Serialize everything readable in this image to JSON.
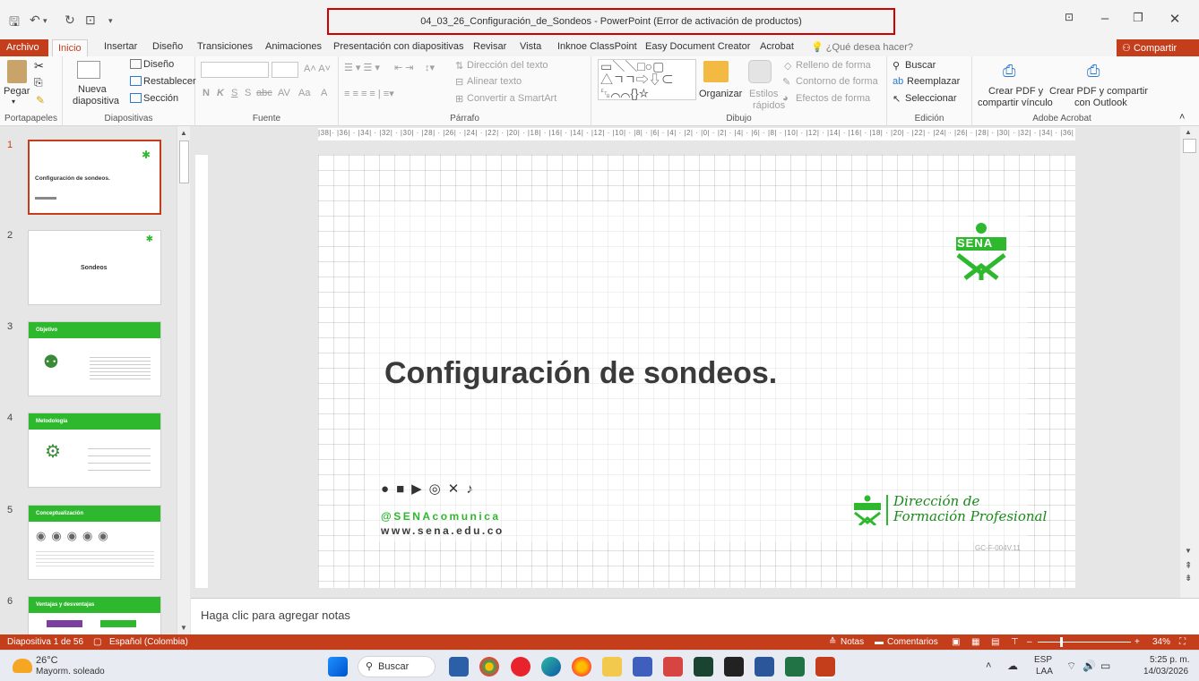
{
  "titlebar": {
    "document_title": "04_03_26_Configuración_de_Sondeos - PowerPoint (Error de activación de productos)"
  },
  "tabs": [
    "Archivo",
    "Inicio",
    "Insertar",
    "Diseño",
    "Transiciones",
    "Animaciones",
    "Presentación con diapositivas",
    "Revisar",
    "Vista",
    "Inknoe ClassPoint",
    "Easy Document Creator",
    "Acrobat"
  ],
  "tell_me": "¿Qué desea hacer?",
  "share_label": "Compartir",
  "ribbon": {
    "portapapeles": {
      "label": "Portapapeles",
      "pegar": "Pegar"
    },
    "diapositivas": {
      "label": "Diapositivas",
      "nueva": "Nueva",
      "diapositiva": "diapositiva",
      "diseno": "Diseño",
      "restablecer": "Restablecer",
      "seccion": "Sección"
    },
    "fuente": {
      "label": "Fuente"
    },
    "parrafo": {
      "label": "Párrafo",
      "direccion": "Dirección del texto",
      "alinear": "Alinear texto",
      "smartart": "Convertir a SmartArt"
    },
    "dibujo": {
      "label": "Dibujo",
      "organizar": "Organizar",
      "estilos": "Estilos",
      "rapidos": "rápidos",
      "relleno": "Relleno de forma",
      "contorno": "Contorno de forma",
      "efectos": "Efectos de forma"
    },
    "edicion": {
      "label": "Edición",
      "buscar": "Buscar",
      "reemplazar": "Reemplazar",
      "seleccionar": "Seleccionar"
    },
    "adobe": {
      "label": "Adobe Acrobat",
      "pdf1a": "Crear PDF y",
      "pdf1b": "compartir vínculo",
      "pdf2a": "Crear PDF y compartir",
      "pdf2b": "con Outlook"
    }
  },
  "thumbnails": [
    {
      "num": "1",
      "text": "Configuración de sondeos.",
      "selected": true
    },
    {
      "num": "2",
      "text": "Sondeos"
    },
    {
      "num": "3",
      "text": "Objetivo"
    },
    {
      "num": "4",
      "text": "Metodología"
    },
    {
      "num": "5",
      "text": "Conceptualización"
    },
    {
      "num": "6",
      "text": "Ventajas y desventajas"
    }
  ],
  "ruler_text": "|38|· |36| · |34| · |32| · |30| · |28| · |26| · |24| · |22| · |20| · |18| · |16| · |14| · |12| · |10| · |8| · |6| · |4| · |2| · |0| · |2| · |4| · |6| · |8| · |10| · |12| · |14| · |16| · |18| · |20| · |22| · |24| · |26| · |28| · |30| · |32| · |34| · |36| · |38|",
  "slide": {
    "title": "Configuración de sondeos.",
    "handle": "@SENAcomunica",
    "website": "www.sena.edu.co",
    "logo_text": "SENA",
    "direction_line1": "Dirección de",
    "direction_line2": "Formación Profesional",
    "code": "GC-F-004V.11"
  },
  "notes_placeholder": "Haga clic para agregar notas",
  "status": {
    "slide_counter": "Diapositiva 1 de 56",
    "language": "Español (Colombia)",
    "notes": "Notas",
    "comments": "Comentarios",
    "zoom": "34%"
  },
  "taskbar": {
    "weather_temp": "26°C",
    "weather_desc": "Mayorm. soleado",
    "search": "Buscar",
    "lang1": "ESP",
    "lang2": "LAA",
    "time": "5:25 p. m.",
    "date": "14/03/2026"
  },
  "colors": {
    "accent": "#c43e1c",
    "sena_green": "#2eb82e"
  }
}
